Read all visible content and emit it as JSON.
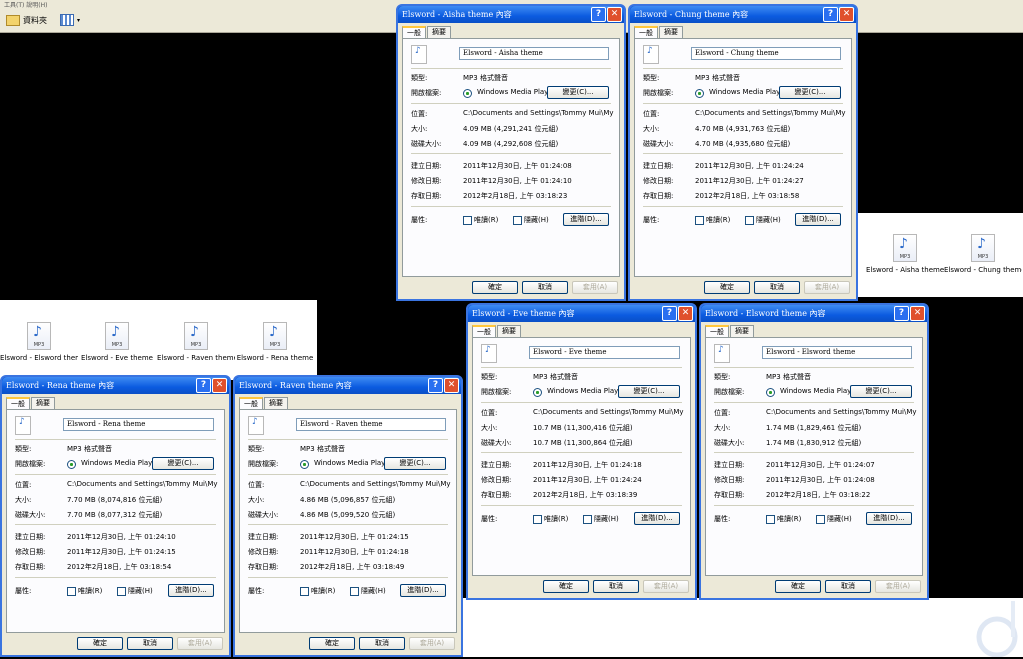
{
  "toolbar": {
    "folders_label": "資料夾",
    "menu_fragment": "工具(T)  說明(H)"
  },
  "files_right": [
    {
      "name": "Elsword - Aisha theme"
    },
    {
      "name": "Elsword - Chung theme"
    }
  ],
  "files_left": [
    {
      "name": "Elsword - Elsword theme"
    },
    {
      "name": "Elsword - Eve theme"
    },
    {
      "name": "Elsword - Raven theme"
    },
    {
      "name": "Elsword - Rena theme"
    }
  ],
  "icon_label": "MP3",
  "common": {
    "tab_general": "一般",
    "tab_summary": "摘要",
    "type_label": "類型:",
    "type_value": "MP3 格式聲音",
    "open_label": "開啟檔案:",
    "open_app": "Windows Media Player",
    "change_btn": "變更(C)...",
    "loc_label": "位置:",
    "location": "C:\\Documents and Settings\\Tommy Mui\\My Documents",
    "size_label": "大小:",
    "disk_label": "磁碟大小:",
    "created_label": "建立日期:",
    "modified_label": "修改日期:",
    "accessed_label": "存取日期:",
    "attr_label": "屬性:",
    "readonly": "唯讀(R)",
    "hidden": "隱藏(H)",
    "advanced_btn": "進階(D)...",
    "ok": "確定",
    "cancel": "取消",
    "apply": "套用(A)"
  },
  "dialogs": {
    "aisha": {
      "title": "Elsword - Aisha theme 內容",
      "name": "Elsword - Aisha theme",
      "size": "4.09 MB (4,291,241 位元組)",
      "disk": "4.09 MB (4,292,608 位元組)",
      "created": "2011年12月30日, 上午 01:24:08",
      "modified": "2011年12月30日, 上午 01:24:10",
      "accessed": "2012年2月18日, 上午 03:18:23"
    },
    "chung": {
      "title": "Elsword - Chung theme 內容",
      "name": "Elsword - Chung theme",
      "size": "4.70 MB (4,931,763 位元組)",
      "disk": "4.70 MB (4,935,680 位元組)",
      "created": "2011年12月30日, 上午 01:24:24",
      "modified": "2011年12月30日, 上午 01:24:27",
      "accessed": "2012年2月18日, 上午 03:18:58"
    },
    "eve": {
      "title": "Elsword - Eve theme 內容",
      "name": "Elsword - Eve theme",
      "size": "10.7 MB (11,300,416 位元組)",
      "disk": "10.7 MB (11,300,864 位元組)",
      "created": "2011年12月30日, 上午 01:24:18",
      "modified": "2011年12月30日, 上午 01:24:24",
      "accessed": "2012年2月18日, 上午 03:18:39"
    },
    "elsword": {
      "title": "Elsword - Elsword theme 內容",
      "name": "Elsword - Elsword theme",
      "size": "1.74 MB (1,829,461 位元組)",
      "disk": "1.74 MB (1,830,912 位元組)",
      "created": "2011年12月30日, 上午 01:24:07",
      "modified": "2011年12月30日, 上午 01:24:08",
      "accessed": "2012年2月18日, 上午 03:18:22"
    },
    "rena": {
      "title": "Elsword - Rena theme 內容",
      "name": "Elsword - Rena theme",
      "size": "7.70 MB (8,074,816 位元組)",
      "disk": "7.70 MB (8,077,312 位元組)",
      "created": "2011年12月30日, 上午 01:24:10",
      "modified": "2011年12月30日, 上午 01:24:15",
      "accessed": "2012年2月18日, 上午 03:18:54"
    },
    "raven": {
      "title": "Elsword - Raven theme 內容",
      "name": "Elsword - Raven theme",
      "size": "4.86 MB (5,096,857 位元組)",
      "disk": "4.86 MB (5,099,520 位元組)",
      "created": "2011年12月30日, 上午 01:24:15",
      "modified": "2011年12月30日, 上午 01:24:18",
      "accessed": "2012年2月18日, 上午 03:18:49"
    }
  }
}
